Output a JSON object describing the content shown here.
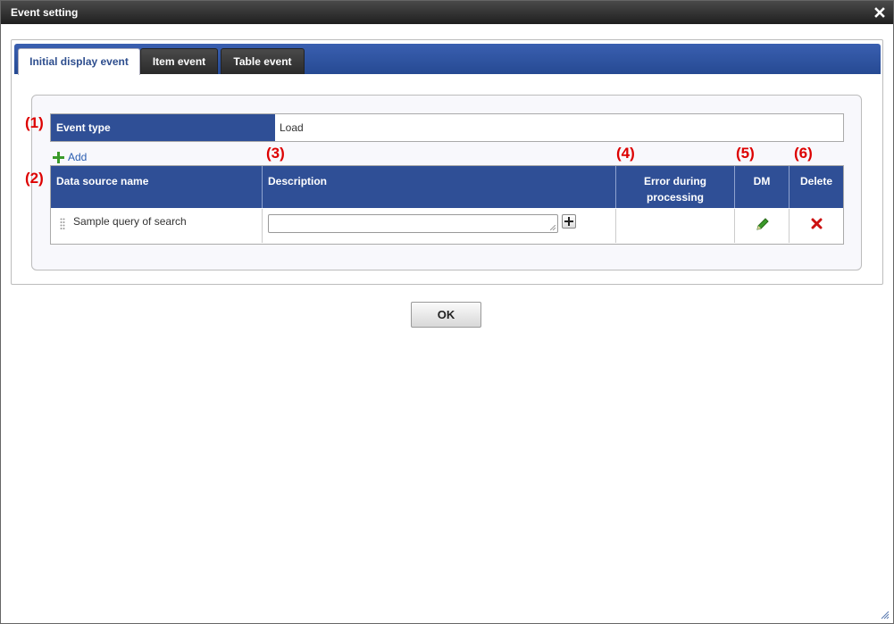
{
  "window": {
    "title": "Event setting"
  },
  "tabs": [
    {
      "label": "Initial display event",
      "active": true
    },
    {
      "label": "Item event",
      "active": false
    },
    {
      "label": "Table event",
      "active": false
    }
  ],
  "markers": [
    "(1)",
    "(2)",
    "(3)",
    "(4)",
    "(5)",
    "(6)"
  ],
  "event_type": {
    "label": "Event type",
    "value": "Load"
  },
  "add_label": "Add",
  "grid": {
    "headers": [
      "Data source name",
      "Description",
      "Error during processing",
      "DM",
      "Delete"
    ],
    "rows": [
      {
        "data_source_name": "Sample query of search",
        "description": "",
        "error_during_processing": ""
      }
    ]
  },
  "ok_label": "OK",
  "colors": {
    "header_blue": "#2f4f96",
    "marker_red": "#dd0000",
    "pencil_green": "#3a9a2a",
    "delete_red": "#cc1111"
  },
  "icons": {
    "close": "close-icon",
    "add": "plus-icon",
    "drag": "drag-handle-icon",
    "expand": "plus-icon",
    "dm": "pencil-icon",
    "delete": "delete-x-icon",
    "resize": "resize-grip-icon"
  }
}
